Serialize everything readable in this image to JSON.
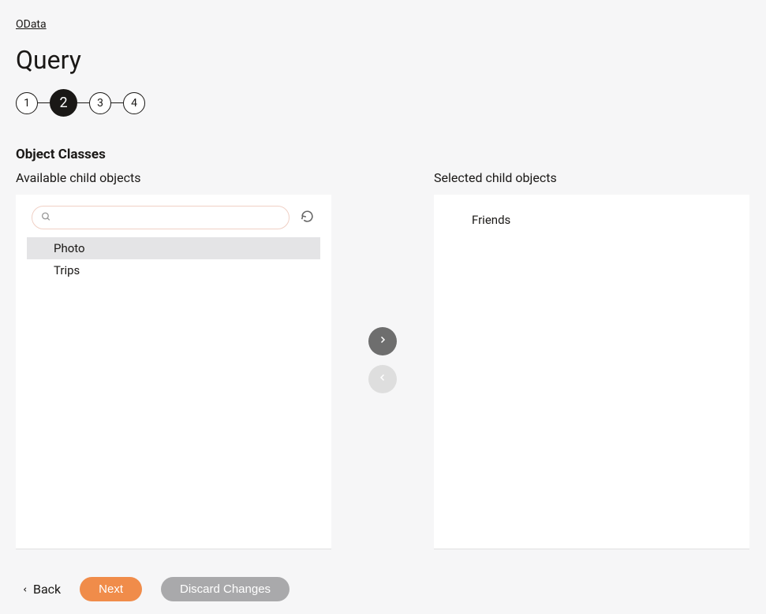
{
  "breadcrumb": "OData",
  "page_title": "Query",
  "stepper": {
    "steps": [
      "1",
      "2",
      "3",
      "4"
    ],
    "active_index": 1
  },
  "section_title": "Object Classes",
  "available": {
    "label": "Available child objects",
    "search_placeholder": "",
    "items": [
      {
        "label": "Photo",
        "selected": true
      },
      {
        "label": "Trips",
        "selected": false
      }
    ]
  },
  "selected": {
    "label": "Selected child objects",
    "items": [
      {
        "label": "Friends"
      }
    ]
  },
  "footer": {
    "back": "Back",
    "next": "Next",
    "discard": "Discard Changes"
  }
}
